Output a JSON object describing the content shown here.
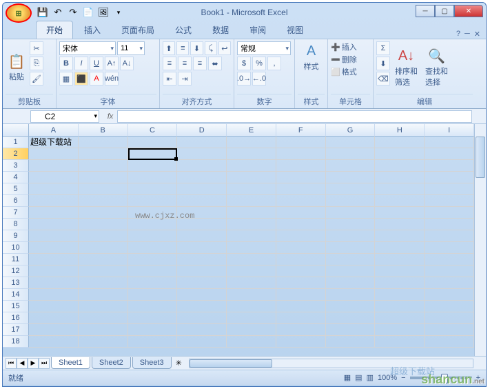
{
  "title": "Book1 - Microsoft Excel",
  "tabs": [
    "开始",
    "插入",
    "页面布局",
    "公式",
    "数据",
    "审阅",
    "视图"
  ],
  "active_tab": 0,
  "ribbon": {
    "clipboard": {
      "label": "剪贴板",
      "paste": "粘贴"
    },
    "font": {
      "label": "字体",
      "name": "宋体",
      "size": "11"
    },
    "alignment": {
      "label": "对齐方式"
    },
    "number": {
      "label": "数字",
      "format": "常规"
    },
    "styles": {
      "label": "样式",
      "btn": "样式"
    },
    "cells": {
      "label": "单元格",
      "insert": "插入",
      "delete": "删除",
      "format": "格式"
    },
    "editing": {
      "label": "编辑",
      "sort": "排序和\n筛选",
      "find": "查找和\n选择"
    }
  },
  "namebox": "C2",
  "columns": [
    "A",
    "B",
    "C",
    "D",
    "E",
    "F",
    "G",
    "H",
    "I"
  ],
  "rows": 18,
  "active_row": 2,
  "cells": {
    "A1": "超级下载站"
  },
  "selected": "C2",
  "watermark": "www.cjxz.com",
  "sheets": [
    "Sheet1",
    "Sheet2",
    "Sheet3"
  ],
  "active_sheet": 0,
  "status": "就绪",
  "zoom": "100%",
  "wm1": "超级下载站",
  "wm2": "shancun"
}
